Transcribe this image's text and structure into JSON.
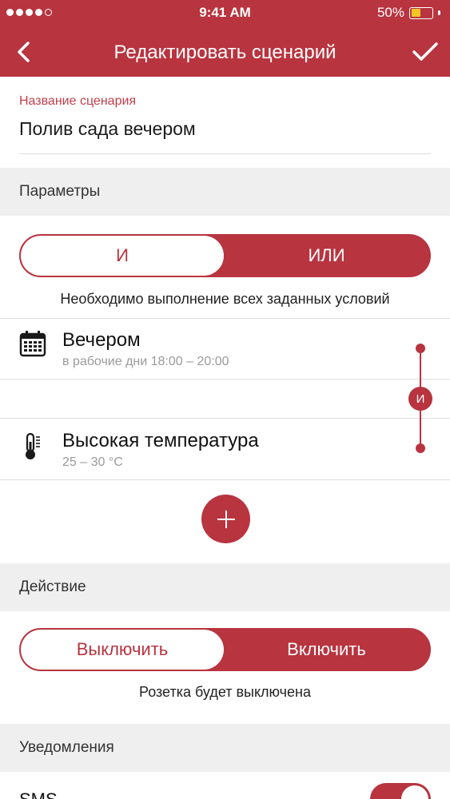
{
  "status": {
    "time": "9:41 AM",
    "battery": "50%",
    "battery_level": 0.5,
    "signal_bars": 4,
    "signal_total": 5
  },
  "nav": {
    "title": "Редактировать сценарий",
    "back_icon": "chevron-left-icon",
    "confirm_icon": "checkmark-icon"
  },
  "scenario": {
    "name_label": "Название сценария",
    "name_value": "Полив сада вечером"
  },
  "parameters": {
    "header": "Параметры",
    "logic": {
      "options": [
        "И",
        "ИЛИ"
      ],
      "selected": "И"
    },
    "hint": "Необходимо выполнение всех заданных условий",
    "conditions": [
      {
        "title": "Вечером",
        "subtitle": "в рабочие дни 18:00 – 20:00",
        "icon": "calendar-icon"
      },
      {
        "title": "Высокая температура",
        "subtitle": "25 – 30 °C",
        "icon": "thermometer-icon"
      }
    ],
    "connector_label": "И"
  },
  "action": {
    "header": "Действие",
    "options": [
      "Выключить",
      "Включить"
    ],
    "selected": "Выключить",
    "hint": "Розетка будет выключена"
  },
  "notifications": {
    "header": "Уведомления",
    "sms_label": "SMS",
    "sms_enabled": true
  },
  "colors": {
    "accent": "#b8343f",
    "section_bg": "#efefef",
    "muted_text": "#9a9a9a",
    "battery": "#f5c623"
  }
}
